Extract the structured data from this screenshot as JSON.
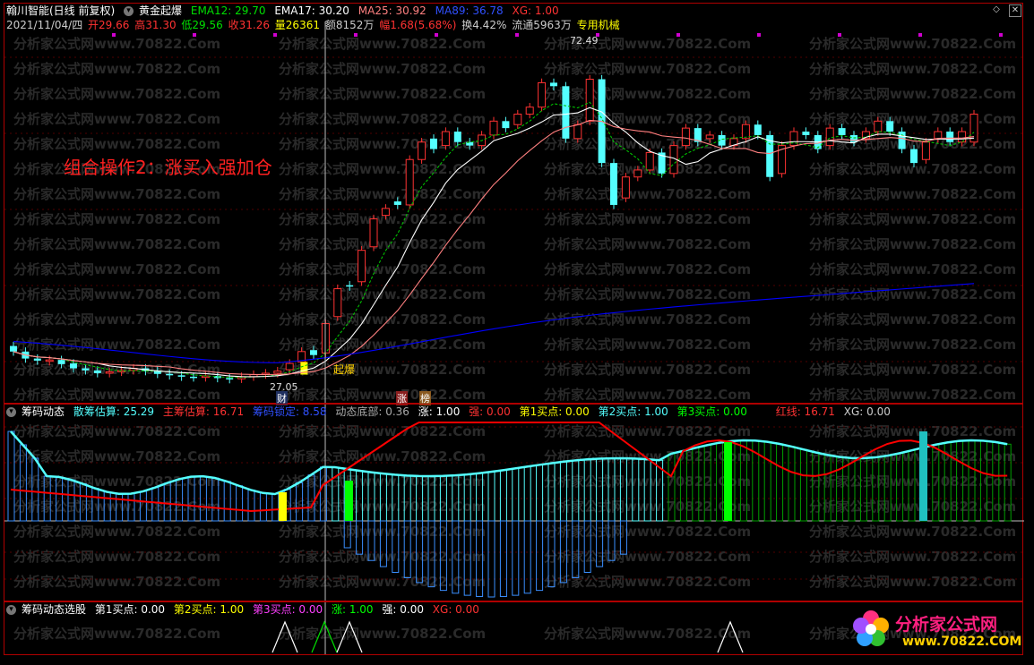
{
  "top": {
    "instrument": "翰川智能(日线 前复权)",
    "formula": "黄金起爆",
    "ema12": "EMA12: 29.70",
    "ema17": "EMA17: 30.20",
    "ma25": "MA25: 30.92",
    "ma89": "MA89: 36.78",
    "xg": "XG: 1.00",
    "date": "2021/11/04/四",
    "open": "开29.66",
    "high": "高31.30",
    "low": "低29.56",
    "close": "收31.26",
    "volume": "量26361",
    "amount": "额8152万",
    "range": "幅1.68(5.68%)",
    "turnover": "换4.42%",
    "float": "流通5963万",
    "industry": "专用机械"
  },
  "annotations": {
    "combo": "组合操作2：涨买入强加仓",
    "high_price": "72.49",
    "low_price": "27.05",
    "qibao": "起爆",
    "cai": "财",
    "zhang_tag": "涨",
    "bang_tag": "榜"
  },
  "panel2": {
    "title": "筹码动态",
    "sancou": "散筹估算: 25.29",
    "zhucou": "主筹估算: 16.71",
    "suoding": "筹码锁定: 8.58",
    "dibu": "动态底部: 0.36",
    "zhang": "涨: 1.00",
    "qiang": "强: 0.00",
    "b1": "第1买点: 0.00",
    "b2": "第2买点: 1.00",
    "b3": "第3买点: 0.00",
    "hongxian": "红线: 16.71",
    "xg": "XG: 0.00"
  },
  "panel3": {
    "title": "筹码动态选股",
    "b1": "第1买点: 0.00",
    "b2": "第2买点: 1.00",
    "b3": "第3买点: 0.00",
    "zhang": "涨: 1.00",
    "qiang": "强: 0.00",
    "xg": "XG: 0.00"
  },
  "watermark": "分析家公式网www.70822.Com",
  "logo": {
    "name": "分析家公式网",
    "url": "www.70822.COM"
  },
  "colors": {
    "up": "#ff3232",
    "down": "#54ffff",
    "ema12": "#00c000",
    "ma25": "#ff8080",
    "ma89": "#0000ff",
    "red_line": "#ff0000"
  }
}
